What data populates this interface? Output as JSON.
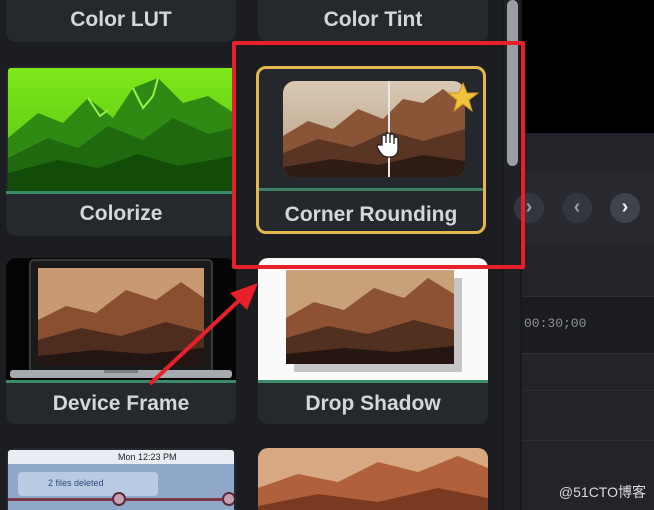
{
  "effects": [
    {
      "label": "Color LUT"
    },
    {
      "label": "Color Tint"
    },
    {
      "label": "Colorize"
    },
    {
      "label": "Corner Rounding",
      "selected": true,
      "favorite": true
    },
    {
      "label": "Device Frame"
    },
    {
      "label": "Drop Shadow"
    }
  ],
  "screen_thumb": {
    "menubar_time": "Mon 12:23 PM",
    "notification": "2 files deleted"
  },
  "timeline": {
    "timecode": "00:30;00"
  },
  "annotation": {
    "highlight_color": "#e8202a",
    "selected_border": "#e4b74e",
    "star_color": "#f2c23e"
  },
  "watermark": "@51CTO博客"
}
